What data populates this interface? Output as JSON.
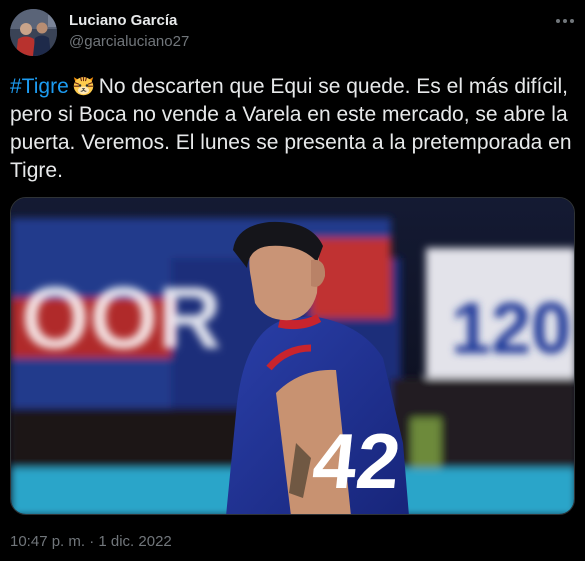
{
  "author": {
    "display_name": "Luciano García",
    "handle": "@garcialuciano27"
  },
  "tweet": {
    "hashtag": "#Tigre",
    "emoji": "tiger-face-emoji",
    "body": "No descarten que Equi se quede. Es el más difícil, pero si Boca no vende a Varela en este mercado, se abre la puerta. Veremos. El lunes se presenta a la pretemporada en Tigre.",
    "timestamp": "10:47 p. m. · 1 dic. 2022"
  },
  "media": {
    "jersey_number": "42",
    "banner_left_text": "OOR",
    "banner_right_text": "120"
  },
  "colors": {
    "background": "#000000",
    "text_primary": "#e7e9ea",
    "text_secondary": "#71767b",
    "link": "#1d9bf0",
    "divider": "#2f3336"
  }
}
